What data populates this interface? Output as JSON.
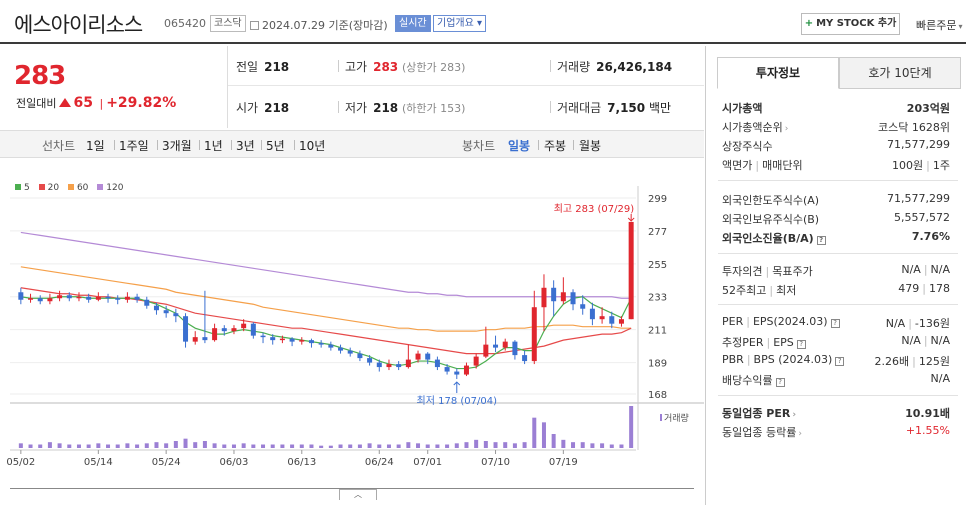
{
  "header": {
    "company": "에스아이리소스",
    "code": "065420",
    "market_badge": "코스닥",
    "date": "2024.07.29",
    "date_suffix": "기준(장마감)",
    "realtime_btn": "실시간",
    "company_info_btn": "기업개요",
    "mystock_btn": "MY STOCK 추가",
    "quick_order": "빠른주문"
  },
  "price": {
    "current": "283",
    "change_label": "전일대비",
    "change_value": "65",
    "change_pct": "+29.82%"
  },
  "stats": {
    "prev_label": "전일",
    "prev_value": "218",
    "high_label": "고가",
    "high_value": "283",
    "high_sub": "(상한가 283)",
    "volume_label": "거래량",
    "volume_value": "26,426,184",
    "open_label": "시가",
    "open_value": "218",
    "low_label": "저가",
    "low_value": "218",
    "low_sub": "(하한가 153)",
    "amount_label": "거래대금",
    "amount_value": "7,150",
    "amount_unit": "백만"
  },
  "period_bar": {
    "line_label": "선차트",
    "line_periods": [
      "1일",
      "1주일",
      "3개월",
      "1년",
      "3년",
      "5년",
      "10년"
    ],
    "candle_label": "봉차트",
    "candle_periods": [
      "일봉",
      "주봉",
      "월봉"
    ],
    "candle_active": "일봉"
  },
  "colors": {
    "up": "#e0262e",
    "down": "#3a6fd0",
    "ma5": "#4caf50",
    "ma20": "#e64a4a",
    "ma60": "#f5a04a",
    "ma120": "#b48ad6",
    "volume": "#9b7fd4"
  },
  "chart_data": {
    "type": "candlestick",
    "legend": [
      "5",
      "20",
      "60",
      "120"
    ],
    "y_ticks": [
      "299",
      "277",
      "255",
      "233",
      "211",
      "189",
      "168"
    ],
    "ylim": [
      168,
      299
    ],
    "x_ticks": [
      "05/02",
      "05/14",
      "05/24",
      "06/03",
      "06/13",
      "06/24",
      "07/01",
      "07/10",
      "07/19"
    ],
    "high_annotation": "최고 283 (07/29)",
    "low_annotation": "최저 178 (07/04)",
    "volume_label": "거래량",
    "candles": [
      {
        "o": 236,
        "c": 231,
        "h": 239,
        "l": 228
      },
      {
        "o": 231,
        "c": 232,
        "h": 235,
        "l": 229
      },
      {
        "o": 232,
        "c": 230,
        "h": 234,
        "l": 228
      },
      {
        "o": 230,
        "c": 232,
        "h": 235,
        "l": 228
      },
      {
        "o": 232,
        "c": 234,
        "h": 237,
        "l": 230
      },
      {
        "o": 234,
        "c": 232,
        "h": 236,
        "l": 230
      },
      {
        "o": 232,
        "c": 233,
        "h": 236,
        "l": 230
      },
      {
        "o": 233,
        "c": 231,
        "h": 235,
        "l": 229
      },
      {
        "o": 231,
        "c": 233,
        "h": 236,
        "l": 230
      },
      {
        "o": 233,
        "c": 232,
        "h": 235,
        "l": 229
      },
      {
        "o": 232,
        "c": 231,
        "h": 234,
        "l": 228
      },
      {
        "o": 231,
        "c": 233,
        "h": 236,
        "l": 229
      },
      {
        "o": 233,
        "c": 231,
        "h": 235,
        "l": 229
      },
      {
        "o": 231,
        "c": 227,
        "h": 233,
        "l": 225
      },
      {
        "o": 227,
        "c": 224,
        "h": 229,
        "l": 221
      },
      {
        "o": 224,
        "c": 222,
        "h": 227,
        "l": 219
      },
      {
        "o": 222,
        "c": 220,
        "h": 225,
        "l": 216
      },
      {
        "o": 220,
        "c": 203,
        "h": 222,
        "l": 199
      },
      {
        "o": 203,
        "c": 206,
        "h": 210,
        "l": 201
      },
      {
        "o": 206,
        "c": 204,
        "h": 237,
        "l": 202
      },
      {
        "o": 204,
        "c": 212,
        "h": 215,
        "l": 203
      },
      {
        "o": 212,
        "c": 210,
        "h": 214,
        "l": 207
      },
      {
        "o": 210,
        "c": 212,
        "h": 214,
        "l": 208
      },
      {
        "o": 212,
        "c": 215,
        "h": 218,
        "l": 210
      },
      {
        "o": 215,
        "c": 207,
        "h": 216,
        "l": 205
      },
      {
        "o": 207,
        "c": 206,
        "h": 209,
        "l": 202
      },
      {
        "o": 206,
        "c": 204,
        "h": 208,
        "l": 201
      },
      {
        "o": 204,
        "c": 205,
        "h": 207,
        "l": 202
      },
      {
        "o": 205,
        "c": 203,
        "h": 206,
        "l": 200
      },
      {
        "o": 203,
        "c": 204,
        "h": 206,
        "l": 201
      },
      {
        "o": 204,
        "c": 202,
        "h": 205,
        "l": 199
      },
      {
        "o": 202,
        "c": 201,
        "h": 204,
        "l": 199
      },
      {
        "o": 201,
        "c": 199,
        "h": 203,
        "l": 197
      },
      {
        "o": 199,
        "c": 197,
        "h": 201,
        "l": 195
      },
      {
        "o": 197,
        "c": 195,
        "h": 199,
        "l": 193
      },
      {
        "o": 195,
        "c": 192,
        "h": 197,
        "l": 190
      },
      {
        "o": 192,
        "c": 189,
        "h": 194,
        "l": 187
      },
      {
        "o": 189,
        "c": 186,
        "h": 191,
        "l": 183
      },
      {
        "o": 186,
        "c": 188,
        "h": 191,
        "l": 184
      },
      {
        "o": 188,
        "c": 186,
        "h": 190,
        "l": 184
      },
      {
        "o": 186,
        "c": 191,
        "h": 201,
        "l": 185
      },
      {
        "o": 191,
        "c": 195,
        "h": 197,
        "l": 189
      },
      {
        "o": 195,
        "c": 191,
        "h": 196,
        "l": 188
      },
      {
        "o": 191,
        "c": 186,
        "h": 193,
        "l": 184
      },
      {
        "o": 186,
        "c": 183,
        "h": 188,
        "l": 181
      },
      {
        "o": 183,
        "c": 181,
        "h": 185,
        "l": 178
      },
      {
        "o": 181,
        "c": 187,
        "h": 189,
        "l": 180
      },
      {
        "o": 187,
        "c": 193,
        "h": 195,
        "l": 185
      },
      {
        "o": 193,
        "c": 201,
        "h": 213,
        "l": 192
      },
      {
        "o": 201,
        "c": 199,
        "h": 207,
        "l": 196
      },
      {
        "o": 199,
        "c": 203,
        "h": 205,
        "l": 197
      },
      {
        "o": 203,
        "c": 194,
        "h": 204,
        "l": 191
      },
      {
        "o": 194,
        "c": 190,
        "h": 197,
        "l": 188
      },
      {
        "o": 190,
        "c": 226,
        "h": 237,
        "l": 188
      },
      {
        "o": 226,
        "c": 239,
        "h": 248,
        "l": 210
      },
      {
        "o": 239,
        "c": 230,
        "h": 244,
        "l": 220
      },
      {
        "o": 230,
        "c": 236,
        "h": 246,
        "l": 228
      },
      {
        "o": 236,
        "c": 228,
        "h": 238,
        "l": 224
      },
      {
        "o": 228,
        "c": 225,
        "h": 234,
        "l": 221
      },
      {
        "o": 225,
        "c": 218,
        "h": 229,
        "l": 214
      },
      {
        "o": 218,
        "c": 220,
        "h": 226,
        "l": 215
      },
      {
        "o": 220,
        "c": 215,
        "h": 223,
        "l": 212
      },
      {
        "o": 215,
        "c": 218,
        "h": 220,
        "l": 213
      },
      {
        "o": 218,
        "c": 283,
        "h": 283,
        "l": 218
      }
    ],
    "ma120_values": [
      276,
      275,
      274,
      273,
      272,
      271,
      270,
      269,
      268,
      267,
      266,
      265,
      264,
      263,
      262,
      261,
      260,
      259,
      258,
      257,
      256,
      255,
      254,
      253,
      252,
      251,
      250,
      249,
      248,
      247,
      246,
      245,
      244,
      243,
      242,
      241,
      240,
      239,
      238,
      237,
      236,
      236,
      235,
      235,
      234,
      234,
      233,
      233,
      233,
      233,
      233,
      233,
      233,
      233,
      233,
      233,
      233,
      233,
      233,
      233,
      233,
      233,
      232,
      232
    ],
    "ma60_values": [
      253,
      252,
      251,
      250,
      249,
      248,
      247,
      246,
      245,
      244,
      243,
      242,
      241,
      240,
      239,
      238,
      236,
      235,
      234,
      233,
      232,
      231,
      230,
      229,
      228,
      226,
      225,
      224,
      223,
      222,
      221,
      220,
      219,
      218,
      217,
      216,
      215,
      214,
      213,
      212,
      212,
      211,
      211,
      210,
      210,
      210,
      210,
      210,
      211,
      211,
      212,
      212,
      212,
      213,
      213,
      214,
      214,
      214,
      213,
      213,
      213,
      213,
      212,
      212
    ],
    "ma20_values": [
      239,
      238,
      237,
      236,
      235,
      235,
      234,
      234,
      233,
      233,
      232,
      232,
      231,
      230,
      229,
      228,
      226,
      224,
      222,
      221,
      220,
      219,
      218,
      217,
      216,
      215,
      214,
      213,
      212,
      212,
      211,
      210,
      209,
      208,
      207,
      206,
      205,
      204,
      203,
      202,
      201,
      200,
      199,
      198,
      197,
      196,
      195,
      195,
      195,
      195,
      196,
      197,
      198,
      199,
      200,
      202,
      204,
      205,
      206,
      207,
      208,
      208,
      209,
      212
    ],
    "ma5_values": [
      233,
      232,
      232,
      232,
      233,
      233,
      233,
      232,
      232,
      232,
      232,
      232,
      232,
      230,
      228,
      225,
      222,
      216,
      212,
      210,
      208,
      208,
      210,
      211,
      210,
      209,
      207,
      206,
      205,
      204,
      203,
      202,
      201,
      199,
      197,
      195,
      193,
      190,
      188,
      187,
      188,
      190,
      190,
      189,
      187,
      185,
      185,
      186,
      190,
      195,
      199,
      199,
      197,
      197,
      210,
      220,
      228,
      232,
      233,
      228,
      225,
      222,
      219,
      232
    ],
    "volume_values": [
      4,
      3,
      3,
      5,
      4,
      3,
      3,
      3,
      4,
      3,
      3,
      4,
      3,
      4,
      5,
      4,
      6,
      8,
      5,
      6,
      4,
      3,
      3,
      4,
      3,
      3,
      3,
      3,
      3,
      3,
      3,
      2,
      2,
      3,
      3,
      3,
      4,
      3,
      3,
      3,
      5,
      4,
      3,
      3,
      3,
      4,
      5,
      7,
      6,
      5,
      5,
      4,
      5,
      26,
      22,
      12,
      7,
      5,
      5,
      4,
      4,
      3,
      3,
      36
    ]
  },
  "investment": {
    "tab_active": "투자정보",
    "tab_other": "호가 10단계",
    "market_cap_label": "시가총액",
    "market_cap_value": "203억원",
    "rank_label": "시가총액순위",
    "rank_value": "코스닥 1628위",
    "shares_label": "상장주식수",
    "shares_value": "71,577,299",
    "par_label": "액면가",
    "trade_unit_label": "매매단위",
    "par_value": "100원",
    "trade_unit_value": "1주",
    "foreign_limit_label": "외국인한도주식수(A)",
    "foreign_limit_value": "71,577,299",
    "foreign_hold_label": "외국인보유주식수(B)",
    "foreign_hold_value": "5,557,572",
    "foreign_ratio_label": "외국인소진율(B/A)",
    "foreign_ratio_value": "7.76%",
    "opinion_label": "투자의견",
    "target_label": "목표주가",
    "opinion_value": "N/A",
    "target_value": "N/A",
    "week52_high_label": "52주최고",
    "week52_low_label": "최저",
    "week52_high_value": "479",
    "week52_low_value": "178",
    "per_label": "PER",
    "eps_label": "EPS(2024.03)",
    "per_value": "N/A",
    "eps_value": "-136원",
    "est_per_label": "추정PER",
    "est_eps_label": "EPS",
    "est_per_value": "N/A",
    "est_eps_value": "N/A",
    "pbr_label": "PBR",
    "bps_label": "BPS (2024.03)",
    "pbr_value": "2.26배",
    "bps_value": "125원",
    "dividend_label": "배당수익률",
    "dividend_value": "N/A",
    "sector_per_label": "동일업종 PER",
    "sector_per_value": "10.91배",
    "sector_change_label": "동일업종 등락률",
    "sector_change_value": "+1.55%"
  }
}
